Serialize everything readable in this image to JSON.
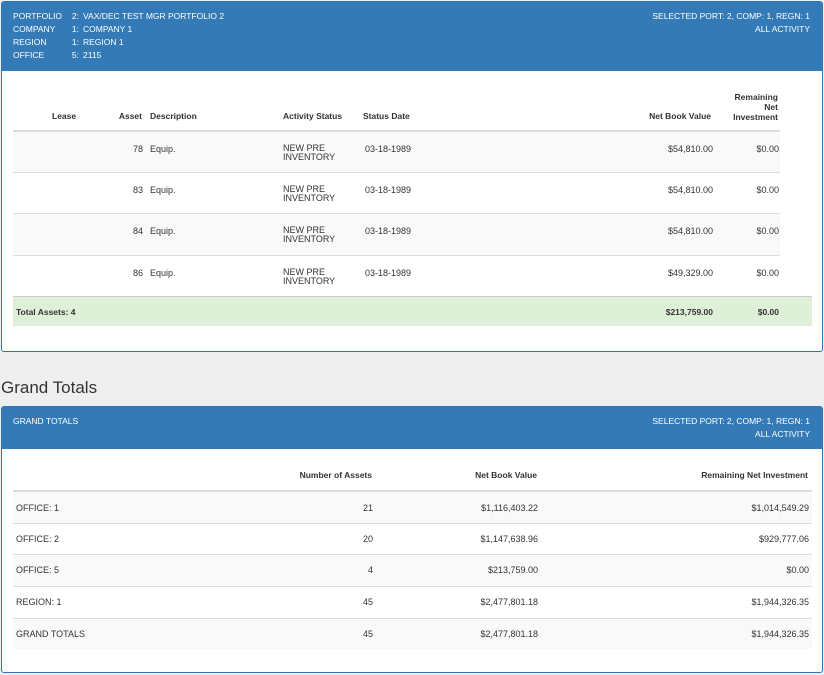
{
  "report_header": {
    "fields": [
      {
        "key": "PORTFOLIO",
        "num": "2:",
        "value": "VAX/DEC TEST MGR PORTFOLIO 2"
      },
      {
        "key": "COMPANY",
        "num": "1:",
        "value": "COMPANY 1"
      },
      {
        "key": "REGION",
        "num": "1:",
        "value": "REGION 1"
      },
      {
        "key": "OFFICE",
        "num": "5:",
        "value": "2115"
      }
    ],
    "selected": "SELECTED PORT: 2, COMP: 1, REGN: 1",
    "activity": "ALL ACTIVITY"
  },
  "asset_table": {
    "columns": {
      "lease": "Lease",
      "asset": "Asset",
      "description": "Description",
      "activity_status": "Activity Status",
      "status_date": "Status Date",
      "net_book_value": "Net Book Value",
      "remaining_1": "Remaining",
      "remaining_2": "Net",
      "remaining_3": "Investment"
    },
    "rows": [
      {
        "lease": "",
        "asset": "78",
        "description": "Equip.",
        "status_1": "NEW PRE",
        "status_2": "INVENTORY",
        "date": "03-18-1989",
        "nbv": "$54,810.00",
        "rni": "$0.00"
      },
      {
        "lease": "",
        "asset": "83",
        "description": "Equip.",
        "status_1": "NEW PRE",
        "status_2": "INVENTORY",
        "date": "03-18-1989",
        "nbv": "$54,810.00",
        "rni": "$0.00"
      },
      {
        "lease": "",
        "asset": "84",
        "description": "Equip.",
        "status_1": "NEW PRE",
        "status_2": "INVENTORY",
        "date": "03-18-1989",
        "nbv": "$54,810.00",
        "rni": "$0.00"
      },
      {
        "lease": "",
        "asset": "86",
        "description": "Equip.",
        "status_1": "NEW PRE",
        "status_2": "INVENTORY",
        "date": "03-18-1989",
        "nbv": "$49,329.00",
        "rni": "$0.00"
      }
    ],
    "total": {
      "label": "Total Assets: 4",
      "nbv": "$213,759.00",
      "rni": "$0.00"
    }
  },
  "grand_section_title": "Grand Totals",
  "grand_header": {
    "title": "GRAND TOTALS",
    "selected": "SELECTED PORT: 2, COMP: 1, REGN: 1",
    "activity": "ALL ACTIVITY"
  },
  "grand_table": {
    "columns": {
      "count": "Number of Assets",
      "nbv": "Net Book Value",
      "rni": "Remaining Net Investment"
    },
    "rows": [
      {
        "label": "OFFICE: 1",
        "count": "21",
        "nbv": "$1,116,403.22",
        "rni": "$1,014,549.29"
      },
      {
        "label": "OFFICE: 2",
        "count": "20",
        "nbv": "$1,147,638.96",
        "rni": "$929,777.06"
      },
      {
        "label": "OFFICE: 5",
        "count": "4",
        "nbv": "$213,759.00",
        "rni": "$0.00"
      },
      {
        "label": "REGION: 1",
        "count": "45",
        "nbv": "$2,477,801.18",
        "rni": "$1,944,326.35"
      },
      {
        "label": "GRAND TOTALS",
        "count": "45",
        "nbv": "$2,477,801.18",
        "rni": "$1,944,326.35"
      }
    ]
  },
  "colors": {
    "header_blue": "#337ab7",
    "total_green": "#dff0d8",
    "stripe": "#f9f9f9"
  }
}
